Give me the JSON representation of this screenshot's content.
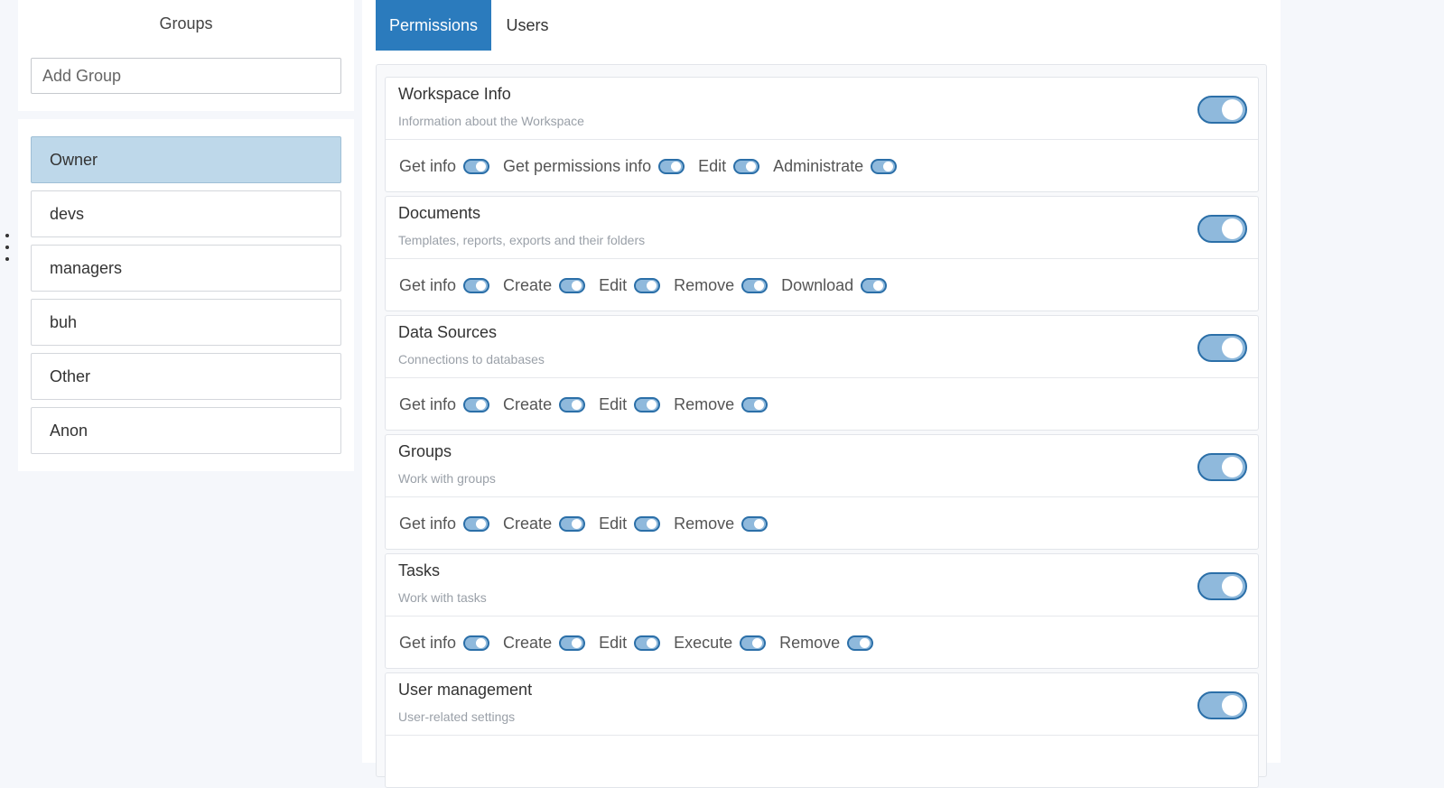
{
  "sidebar": {
    "title": "Groups",
    "add_placeholder": "Add Group",
    "groups": [
      {
        "label": "Owner"
      },
      {
        "label": "devs"
      },
      {
        "label": "managers"
      },
      {
        "label": "buh"
      },
      {
        "label": "Other"
      },
      {
        "label": "Anon"
      }
    ],
    "active_group": "Owner"
  },
  "tabs": [
    {
      "label": "Permissions"
    },
    {
      "label": "Users"
    }
  ],
  "active_tab": "Permissions",
  "sections": [
    {
      "title": "Workspace Info",
      "description": "Information about the Workspace",
      "permissions": [
        "Get info",
        "Get permissions info",
        "Edit",
        "Administrate"
      ]
    },
    {
      "title": "Documents",
      "description": "Templates, reports, exports and their folders",
      "permissions": [
        "Get info",
        "Create",
        "Edit",
        "Remove",
        "Download"
      ]
    },
    {
      "title": "Data Sources",
      "description": "Connections to databases",
      "permissions": [
        "Get info",
        "Create",
        "Edit",
        "Remove"
      ]
    },
    {
      "title": "Groups",
      "description": "Work with groups",
      "permissions": [
        "Get info",
        "Create",
        "Edit",
        "Remove"
      ]
    },
    {
      "title": "Tasks",
      "description": "Work with tasks",
      "permissions": [
        "Get info",
        "Create",
        "Edit",
        "Execute",
        "Remove"
      ]
    },
    {
      "title": "User management",
      "description": "User-related settings",
      "permissions": []
    }
  ],
  "colors": {
    "accent": "#2b7bbd",
    "active_group_bg": "#bed8ea",
    "toggle_on": "#8fb9dc"
  }
}
